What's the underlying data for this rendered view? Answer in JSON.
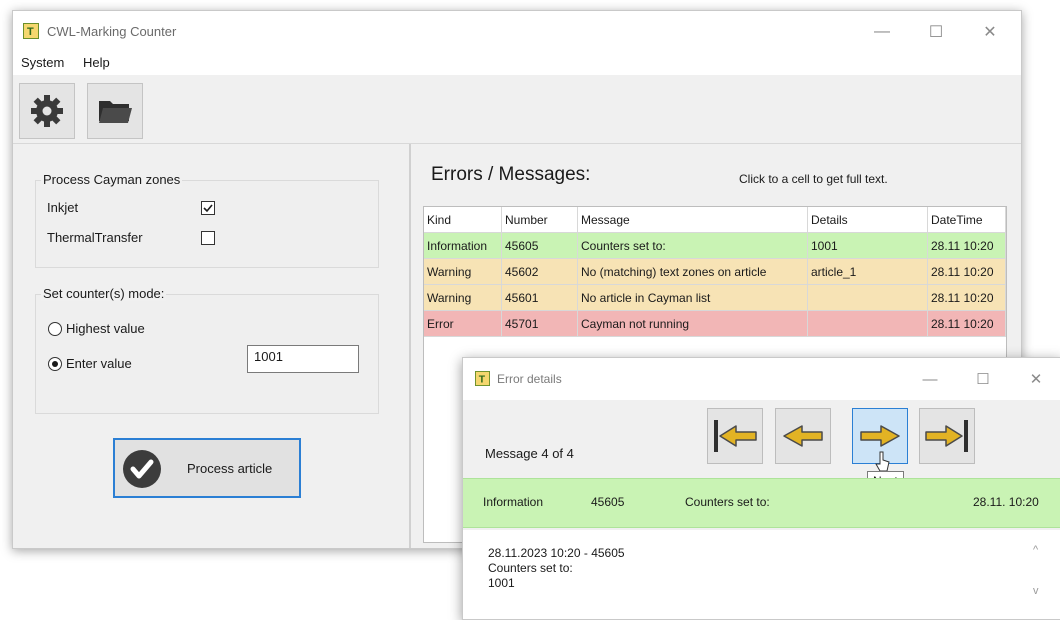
{
  "window": {
    "title": "CWL-Marking Counter",
    "controls": {
      "minimize": "—",
      "maximize": "☐",
      "close": "✕"
    }
  },
  "menu": {
    "items": [
      "System",
      "Help"
    ]
  },
  "toolbar": {
    "icons": [
      "gear-icon",
      "folder-open-icon"
    ]
  },
  "left_panel": {
    "zones_group": {
      "title": "Process Cayman zones",
      "options": [
        {
          "label": "Inkjet",
          "checked": true
        },
        {
          "label": "ThermalTransfer",
          "checked": false
        }
      ]
    },
    "mode_group": {
      "title": "Set counter(s) mode:",
      "options": [
        {
          "label": "Highest value",
          "selected": false
        },
        {
          "label": "Enter value",
          "selected": true
        }
      ],
      "value": "1001"
    },
    "process_button": {
      "label": "Process article"
    }
  },
  "errors_panel": {
    "title": "Errors / Messages:",
    "hint": "Click to a cell to get full text.",
    "columns": [
      "Kind",
      "Number",
      "Message",
      "Details",
      "DateTime"
    ],
    "rows": [
      {
        "kind": "Information",
        "number": "45605",
        "message": "Counters set to:",
        "details": "1001",
        "datetime": "28.11 10:20",
        "color": "#c9f3b4"
      },
      {
        "kind": "Warning",
        "number": "45602",
        "message": "No (matching) text zones on article",
        "details": "article_1",
        "datetime": "28.11 10:20",
        "color": "#f7e3b5"
      },
      {
        "kind": "Warning",
        "number": "45601",
        "message": "No article in Cayman list",
        "details": "",
        "datetime": "28.11 10:20",
        "color": "#f7e3b5"
      },
      {
        "kind": "Error",
        "number": "45701",
        "message": "Cayman not running",
        "details": "",
        "datetime": "28.11 10:20",
        "color": "#f2b6b6"
      }
    ]
  },
  "dialog": {
    "title": "Error details",
    "counter": "Message  4  of  4",
    "tooltip": "Next",
    "nav_buttons": [
      "first-icon",
      "previous-icon",
      "next-icon",
      "last-icon"
    ],
    "info": {
      "kind": "Information",
      "number": "45605",
      "message": "Counters set to:",
      "datetime": "28.11. 10:20"
    },
    "detail_lines": [
      "28.11.2023 10:20 - 45605",
      "Counters set to:",
      "1001"
    ],
    "scroll": {
      "up": "^",
      "down": "v"
    }
  },
  "colors": {
    "info": "#c9f3b4",
    "warning": "#f7e3b5",
    "error": "#f2b6b6",
    "accent": "#2b7fd4"
  }
}
